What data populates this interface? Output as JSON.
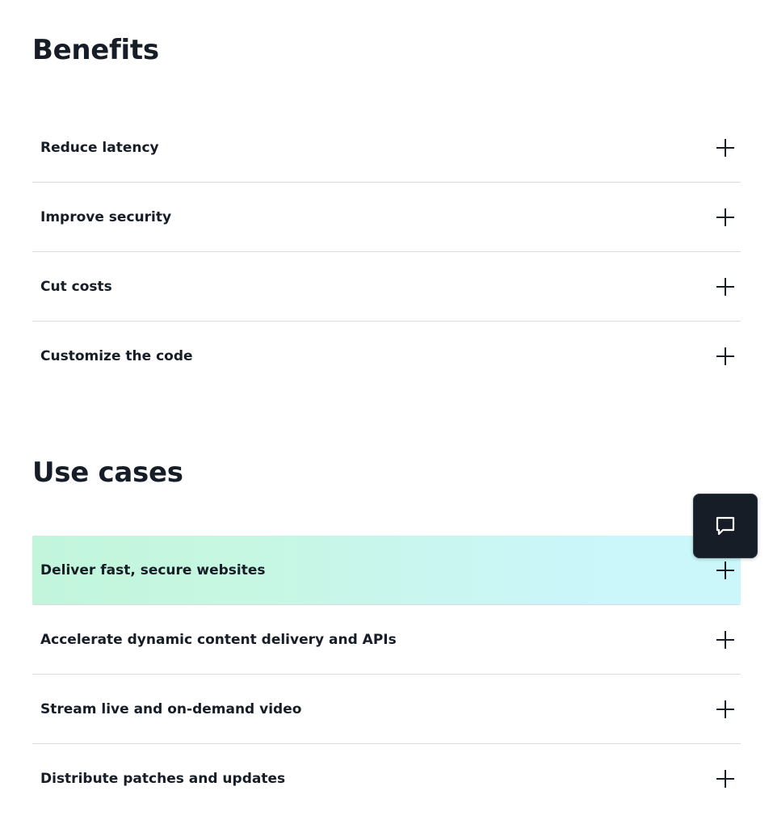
{
  "benefits": {
    "title": "Benefits",
    "items": [
      {
        "label": "Reduce latency"
      },
      {
        "label": "Improve security"
      },
      {
        "label": "Cut costs"
      },
      {
        "label": "Customize the code"
      }
    ]
  },
  "use_cases": {
    "title": "Use cases",
    "items": [
      {
        "label": "Deliver fast, secure websites"
      },
      {
        "label": "Accelerate dynamic content delivery and APIs"
      },
      {
        "label": "Stream live and on-demand video"
      },
      {
        "label": "Distribute patches and updates"
      }
    ]
  },
  "chat": {
    "icon": "chat-bubble-icon"
  },
  "colors": {
    "text": "#161d26",
    "divider": "#d9dcdf",
    "highlight_start": "#c2f5dc",
    "highlight_end": "#cbf7fb",
    "chat_button_bg": "#161d26"
  }
}
